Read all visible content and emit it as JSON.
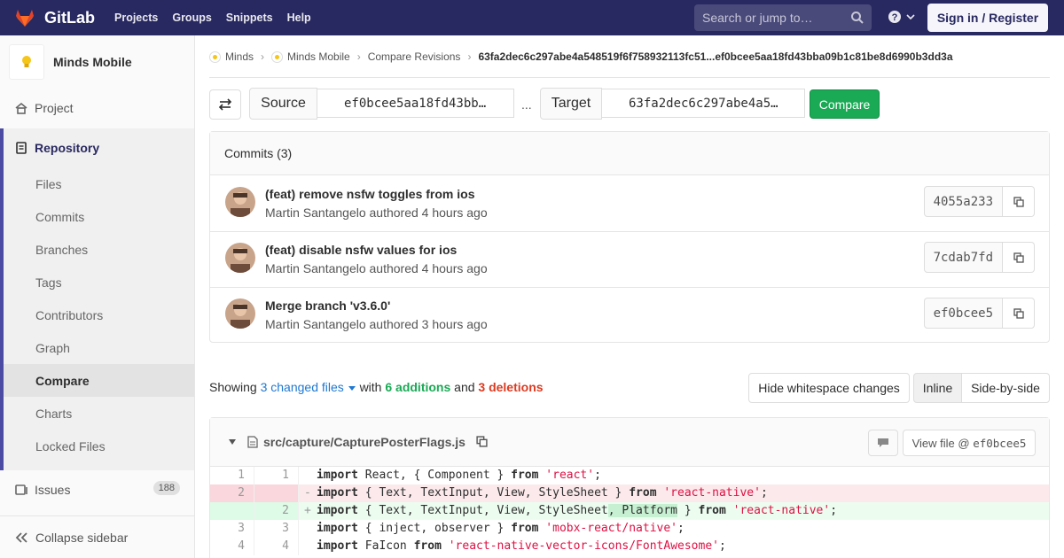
{
  "navbar": {
    "brand": "GitLab",
    "links": [
      "Projects",
      "Groups",
      "Snippets",
      "Help"
    ],
    "search_placeholder": "Search or jump to…",
    "signin": "Sign in / Register"
  },
  "sidebar": {
    "project_name": "Minds Mobile",
    "project": "Project",
    "repository": "Repository",
    "repo_items": [
      "Files",
      "Commits",
      "Branches",
      "Tags",
      "Contributors",
      "Graph",
      "Compare",
      "Charts",
      "Locked Files"
    ],
    "active_item": "Compare",
    "issues": "Issues",
    "issues_count": "188",
    "collapse": "Collapse sidebar"
  },
  "breadcrumbs": {
    "items": [
      "Minds",
      "Minds Mobile",
      "Compare Revisions"
    ],
    "current": "63fa2dec6c297abe4a548519f6f758932113fc51...ef0bcee5aa18fd43bba09b1c81be8d6990b3dd3a"
  },
  "compare": {
    "source_label": "Source",
    "source_value": "ef0bcee5aa18fd43bb…",
    "dots": "...",
    "target_label": "Target",
    "target_value": "63fa2dec6c297abe4a5…",
    "button": "Compare"
  },
  "commits": {
    "header": "Commits (3)",
    "items": [
      {
        "title": "(feat) remove nsfw toggles from ios",
        "meta": "Martin Santangelo authored 4 hours ago",
        "sha": "4055a233"
      },
      {
        "title": "(feat) disable nsfw values for ios",
        "meta": "Martin Santangelo authored 4 hours ago",
        "sha": "7cdab7fd"
      },
      {
        "title": "Merge branch 'v3.6.0'",
        "meta": "Martin Santangelo authored 3 hours ago",
        "sha": "ef0bcee5"
      }
    ]
  },
  "summary": {
    "showing": "Showing",
    "changed": "3 changed files",
    "with": "with",
    "additions": "6 additions",
    "and": "and",
    "deletions": "3 deletions",
    "hide_ws": "Hide whitespace changes",
    "inline": "Inline",
    "side_by_side": "Side-by-side"
  },
  "file": {
    "path": "src/capture/CapturePosterFlags.js",
    "view_file": "View file @",
    "view_sha": "ef0bcee5",
    "lines": [
      {
        "type": "ctx",
        "old": "1",
        "new": "1",
        "sign": "",
        "code": "import React, { Component } from 'react';"
      },
      {
        "type": "old",
        "old": "2",
        "new": "",
        "sign": "-",
        "code": "import { Text, TextInput, View, StyleSheet } from 'react-native';"
      },
      {
        "type": "new",
        "old": "",
        "new": "2",
        "sign": "+",
        "code": "import { Text, TextInput, View, StyleSheet, Platform } from 'react-native';"
      },
      {
        "type": "ctx",
        "old": "3",
        "new": "3",
        "sign": "",
        "code": "import { inject, observer } from 'mobx-react/native';"
      },
      {
        "type": "ctx",
        "old": "4",
        "new": "4",
        "sign": "",
        "code": "import FaIcon from 'react-native-vector-icons/FontAwesome';"
      }
    ]
  },
  "colors": {
    "navbar": "#292961",
    "accent": "#4b4ba3",
    "compare_button": "#1aaa55",
    "additions": "#1aaa55",
    "deletions": "#db3b21",
    "link": "#1f78d1"
  }
}
